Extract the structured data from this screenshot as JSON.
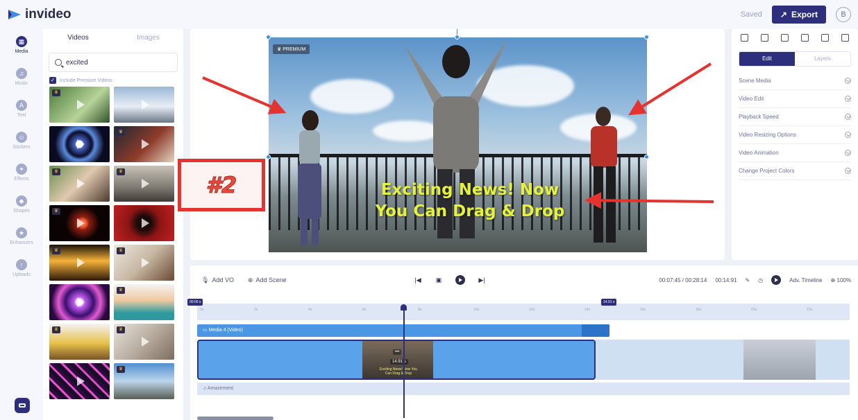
{
  "app": {
    "name": "invideo",
    "saved_label": "Saved",
    "export_label": "Export",
    "avatar_initial": "B"
  },
  "rail": {
    "items": [
      {
        "label": "Media",
        "icon": "media-icon"
      },
      {
        "label": "Music",
        "icon": "music-icon"
      },
      {
        "label": "Text",
        "icon": "text-icon"
      },
      {
        "label": "Stickers",
        "icon": "stickers-icon"
      },
      {
        "label": "Effects",
        "icon": "effects-icon"
      },
      {
        "label": "Shapes",
        "icon": "shapes-icon"
      },
      {
        "label": "Enhancers",
        "icon": "enhancers-icon"
      },
      {
        "label": "Uploads",
        "icon": "uploads-icon"
      }
    ]
  },
  "media": {
    "tabs": [
      "Videos",
      "Images"
    ],
    "search_value": "excited",
    "premium_label": "Include Premium Videos"
  },
  "canvas": {
    "premium_badge": "PREMIUM",
    "overlay_line1": "Exciting News! Now",
    "overlay_line2": "You Can Drag & Drop",
    "annotation": "#2"
  },
  "right_panel": {
    "tabs": [
      "Edit",
      "Layers"
    ],
    "rows": [
      "Scene Media",
      "Video Edit",
      "Playback Speed",
      "Video Resizing Options",
      "Video Animation",
      "Change Project Colors"
    ]
  },
  "timeline": {
    "add_vo": "Add VO",
    "add_scene": "Add Scene",
    "time_readout": "00:07:45 / 00:28:14",
    "scene_duration": "00:14:91",
    "adv_timeline": "Adv. Timeline",
    "zoom": "100%",
    "start_tag": "00:00 s",
    "end_tag": "14.91 s",
    "ruler_ticks": [
      "0s",
      "2s",
      "4s",
      "6s",
      "8s",
      "10s",
      "12s",
      "14s",
      "16s",
      "18s",
      "20s",
      "22s"
    ],
    "media_track": "Media 4 (Video)",
    "clip_duration": "14.91 s",
    "clip_caption": "Exciting News! Now You Can Drag & Drop",
    "audio_track": "Amazement"
  }
}
